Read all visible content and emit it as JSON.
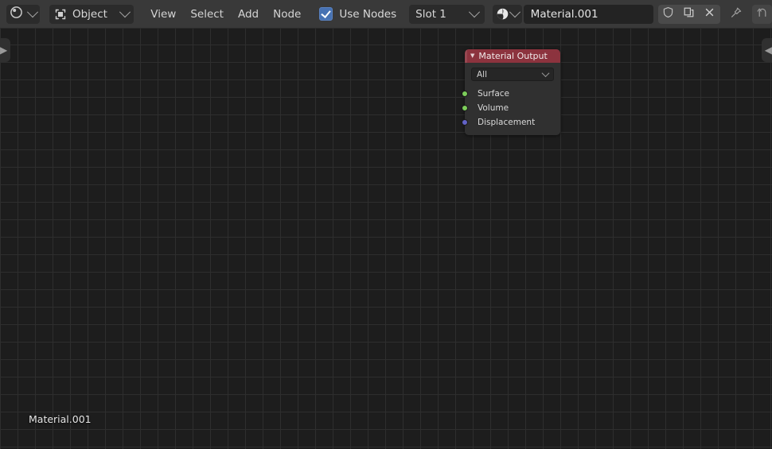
{
  "header": {
    "editor_type": {
      "icon": "shader-editor-sphere-icon",
      "chevron": "chevron-down-icon"
    },
    "shading_type": {
      "icon": "object-bracket-icon",
      "label": "Object",
      "chevron": "chevron-down-icon"
    },
    "menus": [
      {
        "name": "view",
        "label": "View"
      },
      {
        "name": "select",
        "label": "Select"
      },
      {
        "name": "add",
        "label": "Add"
      },
      {
        "name": "node",
        "label": "Node"
      }
    ],
    "use_nodes": {
      "label": "Use Nodes",
      "checked": true
    },
    "slot": {
      "label": "Slot 1",
      "chevron": "chevron-down-icon"
    },
    "material_browse": {
      "icon": "material-sphere-icon",
      "chevron": "chevron-down-icon"
    },
    "material_name": {
      "value": "Material.001",
      "placeholder": "Material"
    },
    "actions": [
      {
        "name": "fake-user-button",
        "icon": "shield-icon"
      },
      {
        "name": "new-material-button",
        "icon": "copy-icon"
      },
      {
        "name": "unlink-material-button",
        "icon": "close-x-icon"
      },
      {
        "name": "pin-button",
        "icon": "pin-icon"
      },
      {
        "name": "go-to-parent-button",
        "icon": "arrow-up-icon"
      }
    ]
  },
  "canvas": {
    "left_toggle": "▶",
    "right_toggle": "◀",
    "overlay_label": "Material.001"
  },
  "node": {
    "title": "Material Output",
    "collapse_glyph": "▼",
    "header_color": "#8c333e",
    "body_color": "#303030",
    "target_dropdown": {
      "label": "All"
    },
    "sockets": [
      {
        "name": "socket-surface",
        "label": "Surface",
        "color": "#7ccd5a"
      },
      {
        "name": "socket-volume",
        "label": "Volume",
        "color": "#7ccd5a"
      },
      {
        "name": "socket-displacement",
        "label": "Displacement",
        "color": "#6363c8"
      }
    ]
  }
}
